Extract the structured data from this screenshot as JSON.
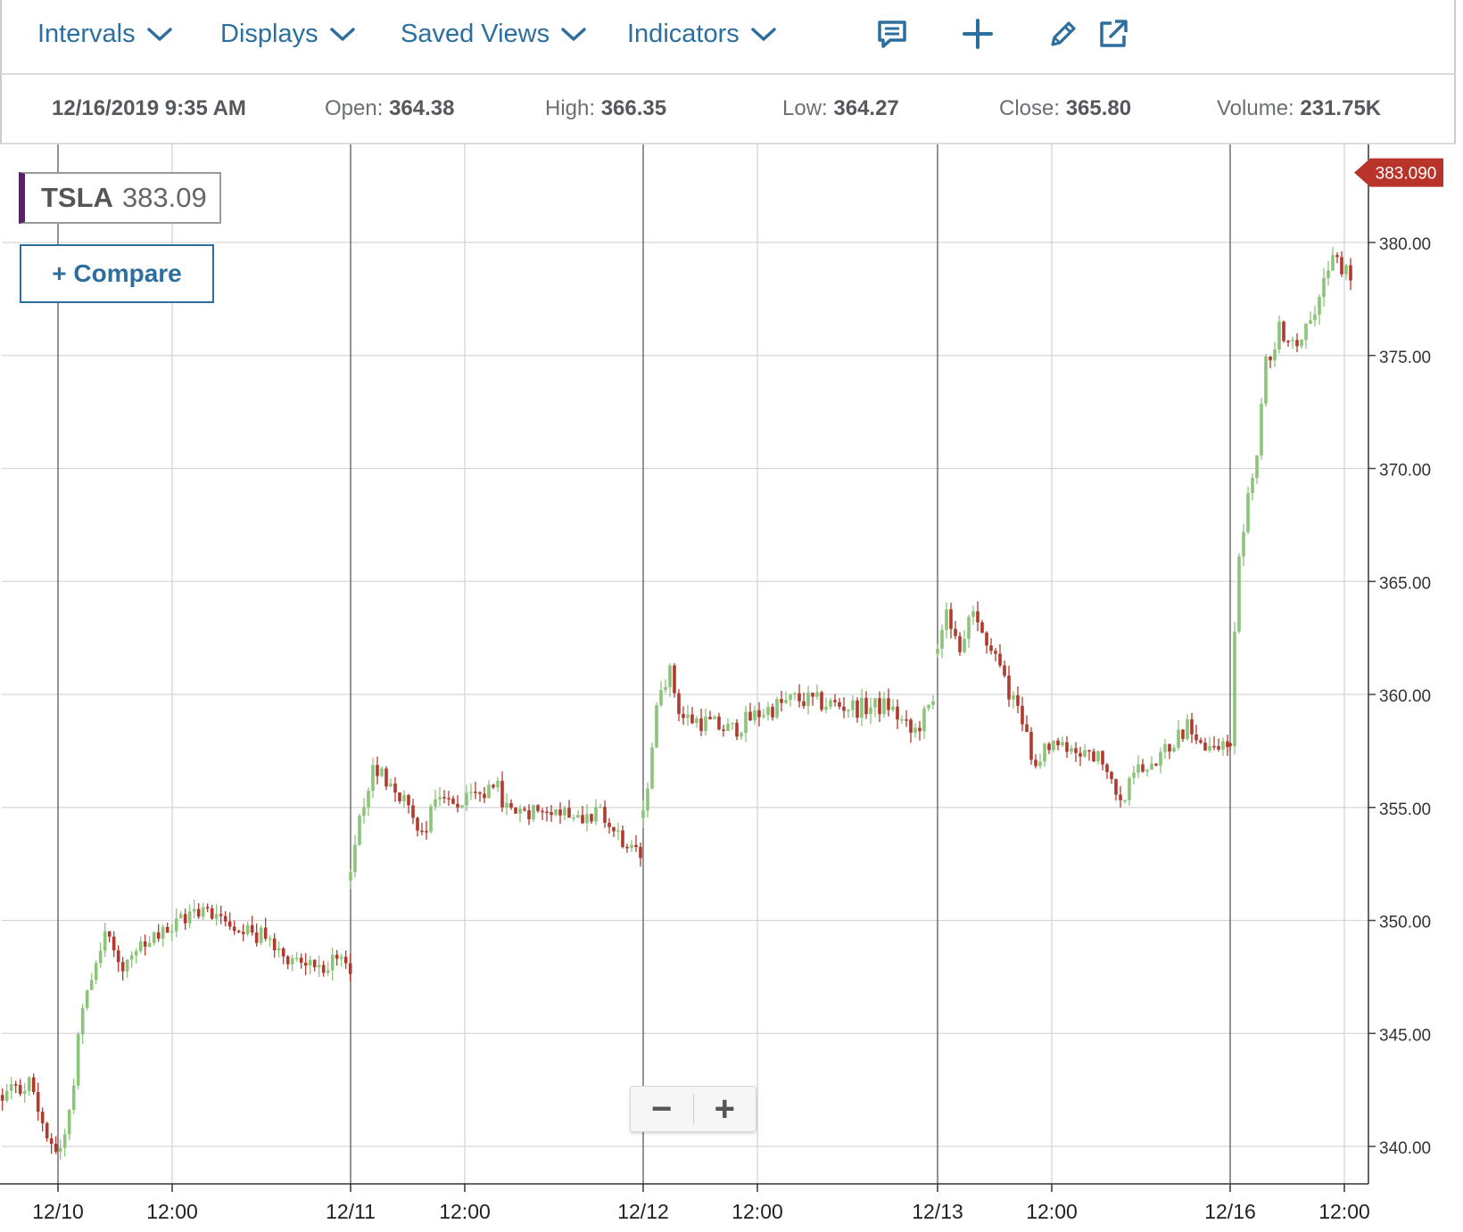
{
  "toolbar": {
    "menus": [
      {
        "label": "Intervals"
      },
      {
        "label": "Displays"
      },
      {
        "label": "Saved Views"
      },
      {
        "label": "Indicators"
      }
    ],
    "tools": [
      "comment-icon",
      "plus-icon",
      "pencil-icon",
      "popout-icon"
    ],
    "accent": "#2c6f9f"
  },
  "info": {
    "datetime": "12/16/2019 9:35 AM",
    "open_label": "Open:",
    "open": "364.38",
    "high_label": "High:",
    "high": "366.35",
    "low_label": "Low:",
    "low": "364.27",
    "close_label": "Close:",
    "close": "365.80",
    "volume_label": "Volume:",
    "volume": "231.75K"
  },
  "legend": {
    "symbol": "TSLA",
    "price": "383.09",
    "color": "#5b1f6b"
  },
  "compare_label": "+ Compare",
  "zoom": {
    "minus": "−",
    "plus": "+"
  },
  "chart_data": {
    "type": "candlestick",
    "ticker": "TSLA",
    "y_range": [
      338.5,
      385.0
    ],
    "y_ticks": [
      "340.00",
      "345.00",
      "350.00",
      "355.00",
      "360.00",
      "365.00",
      "370.00",
      "375.00",
      "380.00"
    ],
    "x_ticks": [
      "12/10",
      "12:00",
      "12/11",
      "12:00",
      "12/12",
      "12:00",
      "12/13",
      "12:00",
      "12/16",
      "12:00"
    ],
    "last_price_label": "383.090",
    "up_color": "#8cc47a",
    "down_color": "#b03a2e",
    "price_tag_color": "#b8342a",
    "grid": true,
    "days": [
      {
        "label": "12/10",
        "path": [
          [
            -0.19,
            342.2
          ],
          [
            -0.1,
            342.8
          ],
          [
            -0.05,
            341.0
          ],
          [
            0.0,
            339.6
          ],
          [
            0.04,
            341.5
          ],
          [
            0.08,
            346.0
          ],
          [
            0.11,
            347.5
          ],
          [
            0.16,
            349.5
          ],
          [
            0.22,
            348.0
          ],
          [
            0.3,
            348.8
          ],
          [
            0.38,
            349.6
          ],
          [
            0.48,
            350.5
          ],
          [
            0.6,
            350.0
          ],
          [
            0.7,
            349.2
          ],
          [
            0.82,
            348.2
          ],
          [
            1.0,
            348.0
          ]
        ]
      },
      {
        "label": "12/11",
        "path": [
          [
            0.0,
            352.0
          ],
          [
            0.04,
            355.0
          ],
          [
            0.08,
            356.8
          ],
          [
            0.13,
            356.2
          ],
          [
            0.2,
            355.0
          ],
          [
            0.24,
            353.8
          ],
          [
            0.3,
            355.5
          ],
          [
            0.4,
            355.2
          ],
          [
            0.5,
            355.8
          ],
          [
            0.56,
            354.5
          ],
          [
            0.66,
            355.2
          ],
          [
            0.74,
            354.8
          ],
          [
            0.86,
            354.6
          ],
          [
            0.94,
            353.2
          ],
          [
            1.0,
            352.8
          ]
        ]
      },
      {
        "label": "12/12",
        "path": [
          [
            0.0,
            354.5
          ],
          [
            0.03,
            357.8
          ],
          [
            0.06,
            360.5
          ],
          [
            0.09,
            361.0
          ],
          [
            0.13,
            359.0
          ],
          [
            0.2,
            358.8
          ],
          [
            0.3,
            358.4
          ],
          [
            0.4,
            359.2
          ],
          [
            0.52,
            359.8
          ],
          [
            0.62,
            359.6
          ],
          [
            0.74,
            359.4
          ],
          [
            0.84,
            359.5
          ],
          [
            0.92,
            358.2
          ],
          [
            1.0,
            359.8
          ]
        ]
      },
      {
        "label": "12/13",
        "path": [
          [
            0.0,
            362.0
          ],
          [
            0.03,
            364.2
          ],
          [
            0.07,
            361.8
          ],
          [
            0.12,
            363.5
          ],
          [
            0.17,
            362.5
          ],
          [
            0.22,
            361.0
          ],
          [
            0.28,
            359.0
          ],
          [
            0.33,
            357.2
          ],
          [
            0.4,
            357.8
          ],
          [
            0.47,
            357.6
          ],
          [
            0.54,
            357.4
          ],
          [
            0.62,
            355.2
          ],
          [
            0.7,
            357.0
          ],
          [
            0.78,
            357.5
          ],
          [
            0.85,
            358.6
          ],
          [
            0.92,
            357.5
          ],
          [
            1.0,
            358.0
          ]
        ]
      },
      {
        "label": "12/16",
        "path": [
          [
            0.0,
            358.0
          ],
          [
            0.02,
            364.5
          ],
          [
            0.05,
            368.0
          ],
          [
            0.09,
            370.2
          ],
          [
            0.12,
            374.5
          ],
          [
            0.17,
            376.2
          ],
          [
            0.23,
            375.6
          ],
          [
            0.3,
            377.5
          ],
          [
            0.36,
            379.5
          ],
          [
            0.42,
            378.0
          ],
          [
            0.48,
            380.0
          ],
          [
            0.52,
            383.1
          ]
        ]
      }
    ]
  }
}
